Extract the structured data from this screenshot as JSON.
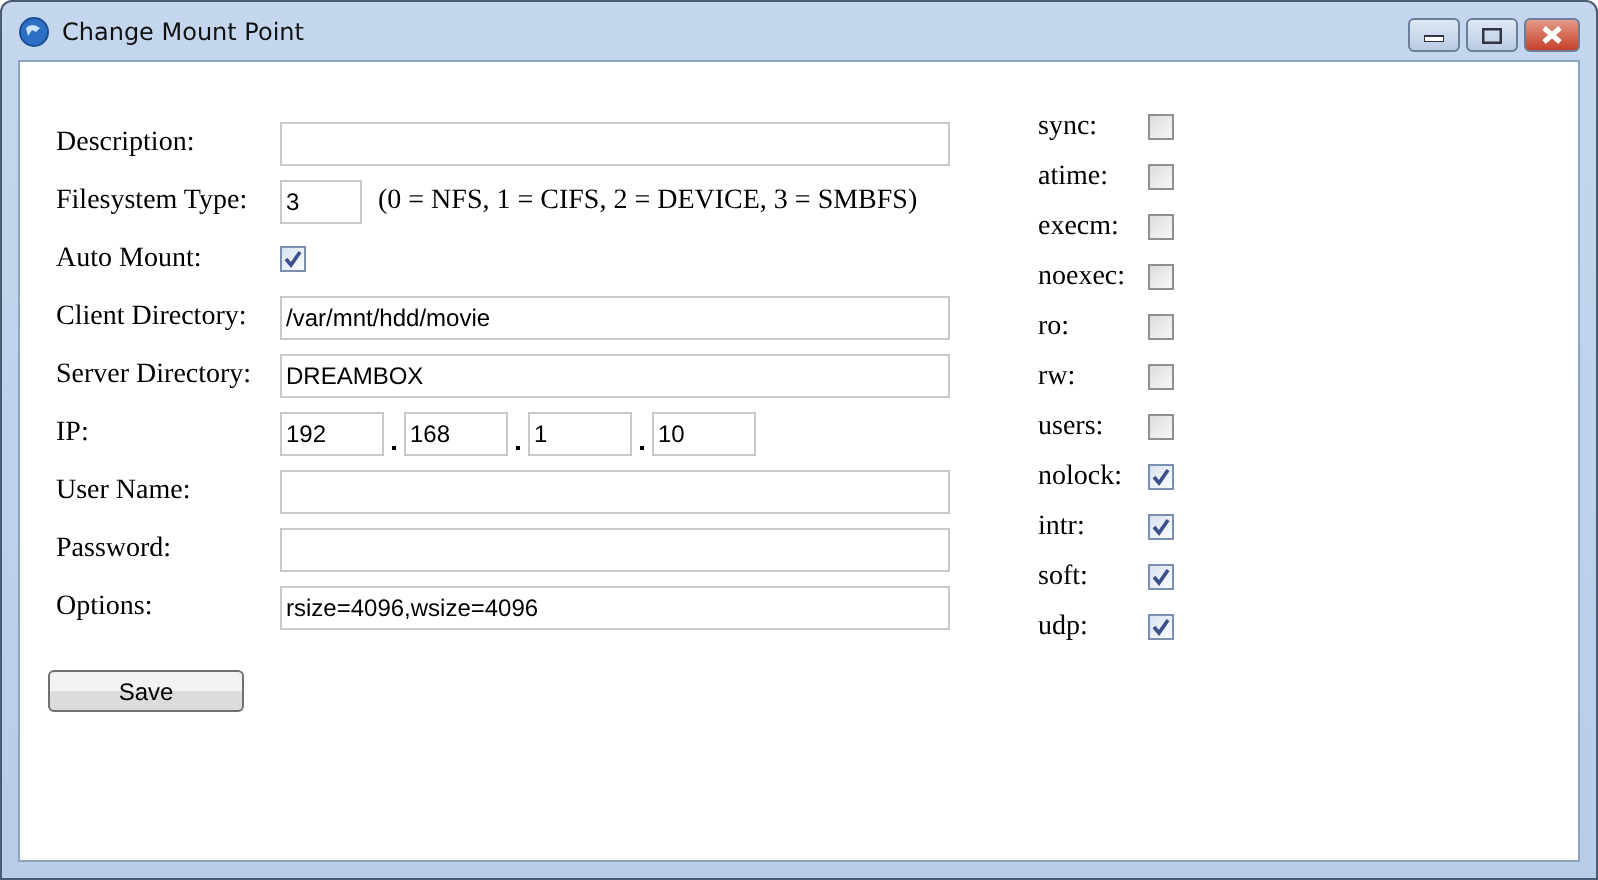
{
  "window": {
    "title": "Change Mount Point"
  },
  "fields": [
    {
      "kind": "text",
      "label": "Description:"
    },
    {
      "kind": "short",
      "label": "Filesystem Type:",
      "value": "3",
      "hint": "(0 = NFS, 1 = CIFS, 2 = DEVICE, 3 = SMBFS)"
    },
    {
      "kind": "checkbox",
      "label": "Auto Mount:",
      "checked": true
    },
    {
      "kind": "text",
      "label": "Client Directory:",
      "value": "/var/mnt/hdd/movie"
    },
    {
      "kind": "text",
      "label": "Server Directory:",
      "value": "DREAMBOX"
    },
    {
      "kind": "ip",
      "label": "IP:",
      "octets": [
        "192",
        "168",
        "1",
        "10"
      ]
    },
    {
      "kind": "text",
      "label": "User Name:"
    },
    {
      "kind": "text",
      "label": "Password:"
    },
    {
      "kind": "text",
      "label": "Options:",
      "value": "rsize=4096,wsize=4096"
    }
  ],
  "flags": [
    {
      "label": "sync:",
      "checked": false
    },
    {
      "label": "atime:",
      "checked": false
    },
    {
      "label": "execm:",
      "checked": false
    },
    {
      "label": "noexec:",
      "checked": false
    },
    {
      "label": "ro:",
      "checked": false
    },
    {
      "label": "rw:",
      "checked": false
    },
    {
      "label": "users:",
      "checked": false
    },
    {
      "label": "nolock:",
      "checked": true
    },
    {
      "label": "intr:",
      "checked": true
    },
    {
      "label": "soft:",
      "checked": true
    },
    {
      "label": "udp:",
      "checked": true
    }
  ],
  "save_button": "Save"
}
